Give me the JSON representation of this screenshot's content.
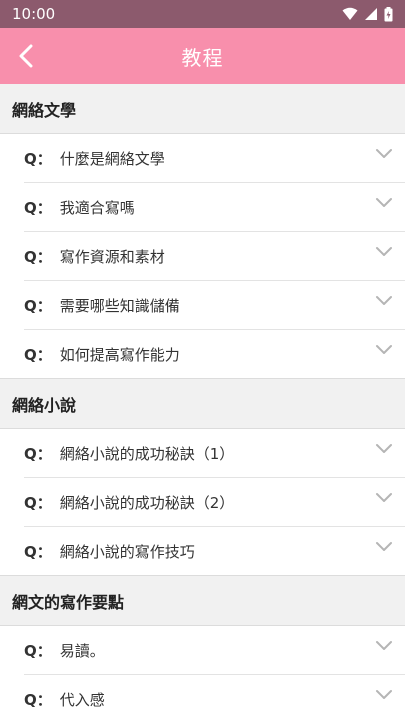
{
  "status": {
    "time": "10:00"
  },
  "appbar": {
    "title": "教程"
  },
  "q_prefix": "Q：",
  "sections": [
    {
      "title": "網絡文學",
      "items": [
        "什麼是網絡文學",
        "我適合寫嗎",
        "寫作資源和素材",
        "需要哪些知識儲備",
        "如何提高寫作能力"
      ]
    },
    {
      "title": "網絡小說",
      "items": [
        "網絡小說的成功秘訣（1）",
        "網絡小說的成功秘訣（2）",
        "網絡小說的寫作技巧"
      ]
    },
    {
      "title": "網文的寫作要點",
      "items": [
        "易讀。",
        "代入感"
      ]
    }
  ],
  "colors": {
    "statusbar": "#8c5a6d",
    "appbar": "#f88fac"
  }
}
